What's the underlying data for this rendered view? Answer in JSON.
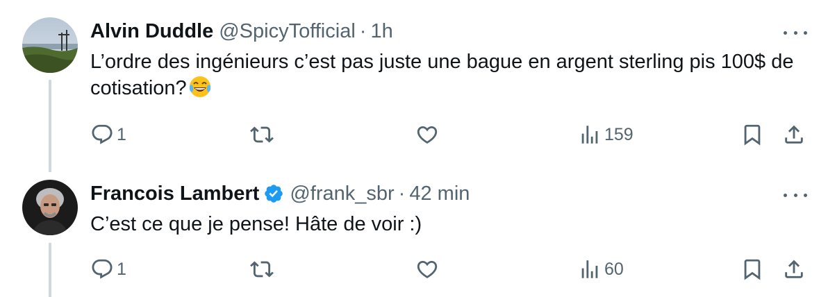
{
  "tweets": [
    {
      "author_name": "Alvin Duddle",
      "handle": "@SpicyTofficial",
      "separator": "·",
      "time": "1h",
      "text": "L’ordre des ingénieurs c’est pas juste une bague en argent sterling pis 100$ de cotisation?",
      "emoji": "face-with-tears-of-joy",
      "verified": false,
      "replies": "1",
      "reposts": "",
      "likes": "",
      "views": "159"
    },
    {
      "author_name": "Francois Lambert",
      "handle": "@frank_sbr",
      "separator": "·",
      "time": "42 min",
      "text": "C’est ce que je pense! Hâte de voir :)",
      "verified": true,
      "replies": "1",
      "reposts": "",
      "likes": "",
      "views": "60"
    }
  ],
  "colors": {
    "text_primary": "#0f1419",
    "text_secondary": "#536471",
    "verified_badge": "#1d9bf0",
    "thread_line": "#cfd9de"
  },
  "icons": [
    "more-icon",
    "reply-icon",
    "repost-icon",
    "like-icon",
    "views-icon",
    "bookmark-icon",
    "share-icon",
    "verified-icon"
  ]
}
